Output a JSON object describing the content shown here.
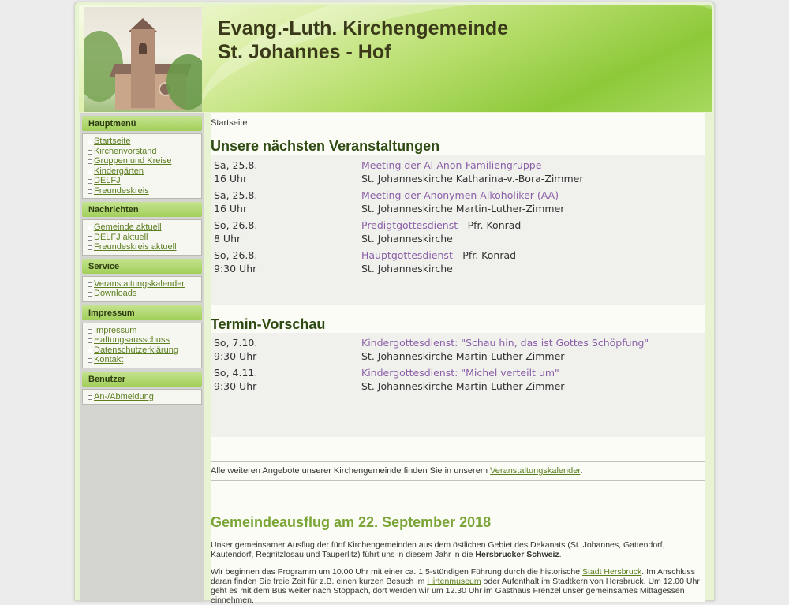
{
  "site": {
    "title_line1": "Evang.-Luth. Kirchengemeinde",
    "title_line2": "St. Johannes - Hof"
  },
  "sidebar": {
    "sections": [
      {
        "heading": "Hauptmenü",
        "items": [
          "Startseite",
          "Kirchenvorstand",
          "Gruppen und Kreise",
          "Kindergärten",
          "DELFJ",
          "Freundeskreis"
        ]
      },
      {
        "heading": "Nachrichten",
        "items": [
          "Gemeinde aktuell",
          "DELFJ aktuell",
          "Freundeskreis aktuell"
        ]
      },
      {
        "heading": "Service",
        "items": [
          "Veranstaltungskalender",
          "Downloads"
        ]
      },
      {
        "heading": "Impressum",
        "items": [
          "Impressum",
          "Haftungsausschuss",
          "Datenschutzerklärung",
          "Kontakt"
        ]
      },
      {
        "heading": "Benutzer",
        "items": [
          "An-/Abmeldung"
        ]
      }
    ]
  },
  "content": {
    "breadcrumb": "Startseite",
    "upcoming_heading": "Unsere nächsten Veranstaltungen",
    "upcoming": [
      {
        "day": "Sa, 25.8.",
        "time": "16 Uhr",
        "title": "Meeting der Al-Anon-Familiengruppe",
        "suffix": "",
        "location": "St. Johanneskirche Katharina-v.-Bora-Zimmer"
      },
      {
        "day": "Sa, 25.8.",
        "time": "16 Uhr",
        "title": "Meeting der Anonymen Alkoholiker (AA)",
        "suffix": "",
        "location": "St. Johanneskirche Martin-Luther-Zimmer"
      },
      {
        "day": "So, 26.8.",
        "time": "8 Uhr",
        "title": "Predigtgottesdienst",
        "suffix": " - Pfr. Konrad",
        "location": "St. Johanneskirche"
      },
      {
        "day": "So, 26.8.",
        "time": "9:30 Uhr",
        "title": "Hauptgottesdienst",
        "suffix": " - Pfr. Konrad",
        "location": "St. Johanneskirche"
      }
    ],
    "preview_heading": "Termin-Vorschau",
    "preview": [
      {
        "day": "So, 7.10.",
        "time": "9:30 Uhr",
        "title": "Kindergottesdienst: \"Schau hin, das ist Gottes Schöpfung\"",
        "suffix": "",
        "location": "St. Johanneskirche Martin-Luther-Zimmer"
      },
      {
        "day": "So, 4.11.",
        "time": "9:30 Uhr",
        "title": "Kindergottesdienst: \"Michel verteilt um\"",
        "suffix": "",
        "location": "St. Johanneskirche Martin-Luther-Zimmer"
      }
    ],
    "info_prefix": "Alle weiteren Angebote unserer Kirchengemeinde finden Sie in unserem ",
    "info_link": "Veranstaltungskalender",
    "info_suffix": ".",
    "article_heading": "Gemeindeausflug am 22. September 2018",
    "article_p1_a": "Unser gemeinsamer Ausflug der fünf Kirchengemeinden aus dem östlichen Gebiet des Dekanats (St. Johannes, Gattendorf, Kautendorf, Regnitzlosau und Tauperlitz) führt uns in diesem Jahr in die ",
    "article_p1_bold": "Hersbrucker Schweiz",
    "article_p1_b": ".",
    "article_p2_a": "Wir beginnen das Programm um 10.00 Uhr mit einer ca. 1,5-stündigen Führung durch die historische ",
    "article_p2_link1": "Stadt Hersbruck",
    "article_p2_b": ". Im Anschluss daran finden Sie freie Zeit für z.B. einen kurzen Besuch im ",
    "article_p2_link2": "Hirtenmuseum",
    "article_p2_c": " oder Aufenthalt im Stadtkern von Hersbruck. Um 12.00 Uhr geht es mit dem Bus weiter nach Stöppach, dort werden wir um 12.30 Uhr im Gasthaus Frenzel unser gemeinsames Mittagessen einnehmen."
  }
}
